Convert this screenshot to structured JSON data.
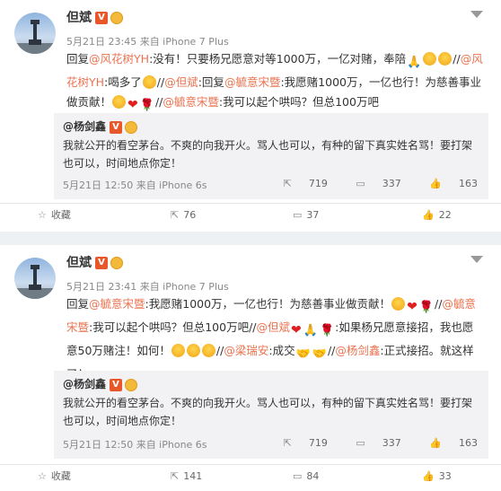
{
  "posts": [
    {
      "author": "但斌",
      "verified_badge": "V",
      "meta": "5月21日 23:45 来自 iPhone 7 Plus",
      "body": {
        "reply_prefix": "回复",
        "mention1": "@风花树YH",
        "text1": ":没有！只要杨兄愿意对等1000万，一亿对赌，奉陪",
        "sep": "//",
        "mention2": "@风花树YH",
        "text2": ":喝多了",
        "sep2": "//",
        "mention3": "@但斌",
        "text3": ":回复",
        "mention4": "@毓意宋暨",
        "text4": ":我愿赌1000万，一亿也行！为慈善事业做贡献！",
        "sep3": "//",
        "mention5": "@毓意宋暨",
        "text5": ":我可以起个哄吗？但总100万吧"
      },
      "quote": {
        "author": "@杨剑鑫",
        "badge": "V",
        "text": "我就公开的看空茅台。不爽的向我开火。骂人也可以，有种的留下真实姓名骂！要打架也可以，时间地点你定！",
        "meta": "5月21日 12:50 来自 iPhone 6s",
        "reposts": "719",
        "comments": "337",
        "likes": "163"
      },
      "actions": {
        "favorite": "收藏",
        "repost": "76",
        "comment": "37",
        "like": "22"
      }
    },
    {
      "author": "但斌",
      "verified_badge": "V",
      "meta": "5月21日 23:41 来自 iPhone 7 Plus",
      "body": {
        "reply_prefix": "回复",
        "mention1": "@毓意宋暨",
        "text1": ":我愿赌1000万，一亿也行！为慈善事业做贡献！",
        "sep": "//",
        "mention2": "@毓意宋暨",
        "text2": ":我可以起个哄吗？但总100万吧",
        "sep2": "//",
        "mention3": "@但斌",
        "text3": ":如果杨兄愿意接招，我也愿意50万赌注！如何！",
        "sep3": "//",
        "mention4": "@梁瑞安",
        "text4": ":成交",
        "sep4": "//",
        "mention5": "@杨剑鑫",
        "text5": ":正式接招。就这样了！"
      },
      "quote": {
        "author": "@杨剑鑫",
        "badge": "V",
        "text": "我就公开的看空茅台。不爽的向我开火。骂人也可以，有种的留下真实姓名骂！要打架也可以，时间地点你定！",
        "meta": "5月21日 12:50 来自 iPhone 6s",
        "reposts": "719",
        "comments": "337",
        "likes": "163"
      },
      "actions": {
        "favorite": "收藏",
        "repost": "141",
        "comment": "84",
        "like": "33"
      }
    }
  ],
  "icons": {
    "favorite": "star-icon",
    "repost": "repost-icon",
    "comment": "comment-icon",
    "like": "thumbs-up-icon",
    "menu": "chevron-down-icon"
  },
  "colors": {
    "link": "#eb7350",
    "badge": "#e8572a",
    "quote_bg": "#f2f2f5",
    "separator": "#eef1f4"
  }
}
